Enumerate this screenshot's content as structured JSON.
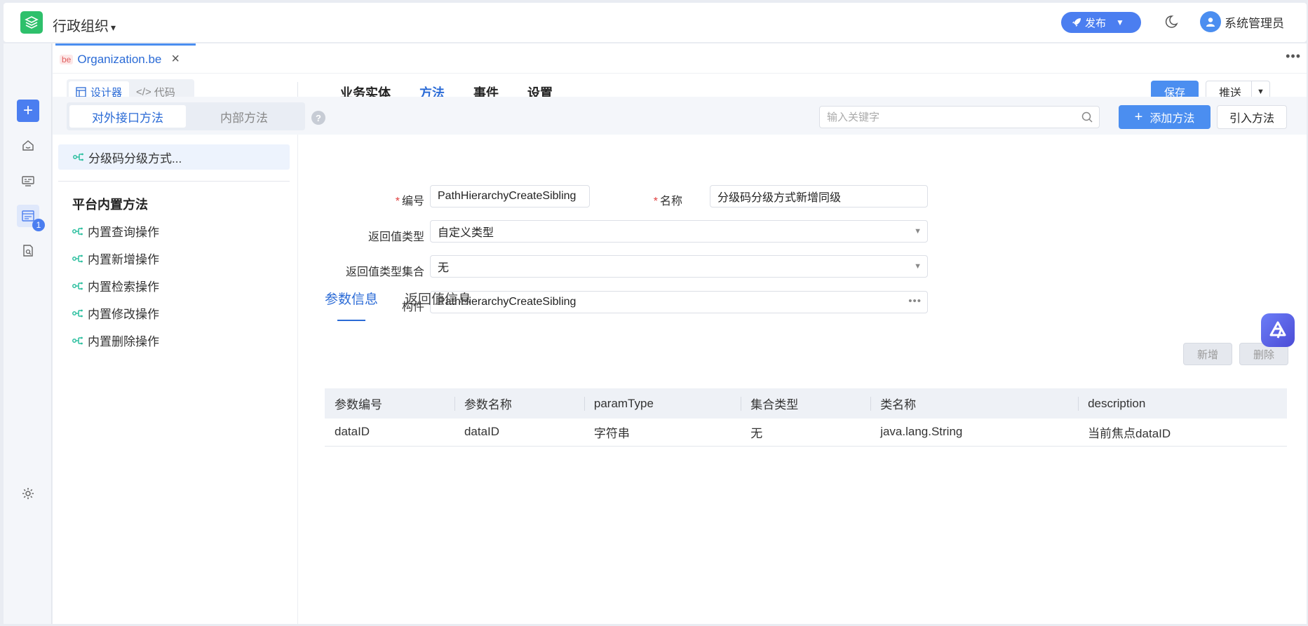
{
  "header": {
    "app_title": "行政组织",
    "publish_label": "发布",
    "user_name": "系统管理员"
  },
  "sidebar": {
    "add_label": "+",
    "badge_count": "1"
  },
  "file_tab": {
    "badge": "be",
    "name": "Organization.be"
  },
  "toolbar": {
    "more": "•••",
    "modes": [
      "设计器",
      "代码"
    ],
    "nav_tabs": [
      "业务实体",
      "方法",
      "事件",
      "设置"
    ],
    "save_label": "保存",
    "push_label": "推送"
  },
  "method_bar": {
    "interface_tabs": [
      "对外接口方法",
      "内部方法"
    ],
    "help": "?",
    "search_placeholder": "输入关键字",
    "add_method_label": "添加方法",
    "import_method_label": "引入方法"
  },
  "method_list": {
    "selected_item": "分级码分级方式...",
    "builtin_title": "平台内置方法",
    "builtin_items": [
      "内置查询操作",
      "内置新增操作",
      "内置检索操作",
      "内置修改操作",
      "内置删除操作"
    ]
  },
  "form": {
    "code_label": "编号",
    "code_value": "PathHierarchyCreateSibling",
    "name_label": "名称",
    "name_value": "分级码分级方式新增同级",
    "return_type_label": "返回值类型",
    "return_type_value": "自定义类型",
    "return_collection_label": "返回值类型集合",
    "return_collection_value": "无",
    "component_label": "构件",
    "component_value": "PathHierarchyCreateSibling"
  },
  "detail": {
    "tabs": [
      "参数信息",
      "返回值信息"
    ],
    "add_label": "新增",
    "delete_label": "删除"
  },
  "params_table": {
    "headers": [
      "参数编号",
      "参数名称",
      "paramType",
      "集合类型",
      "类名称",
      "description"
    ],
    "rows": [
      [
        "dataID",
        "dataID",
        "字符串",
        "无",
        "java.lang.String",
        "当前焦点dataID"
      ]
    ]
  },
  "colors": {
    "accent": "#4b8ef0",
    "brand_green": "#2ec06b"
  }
}
